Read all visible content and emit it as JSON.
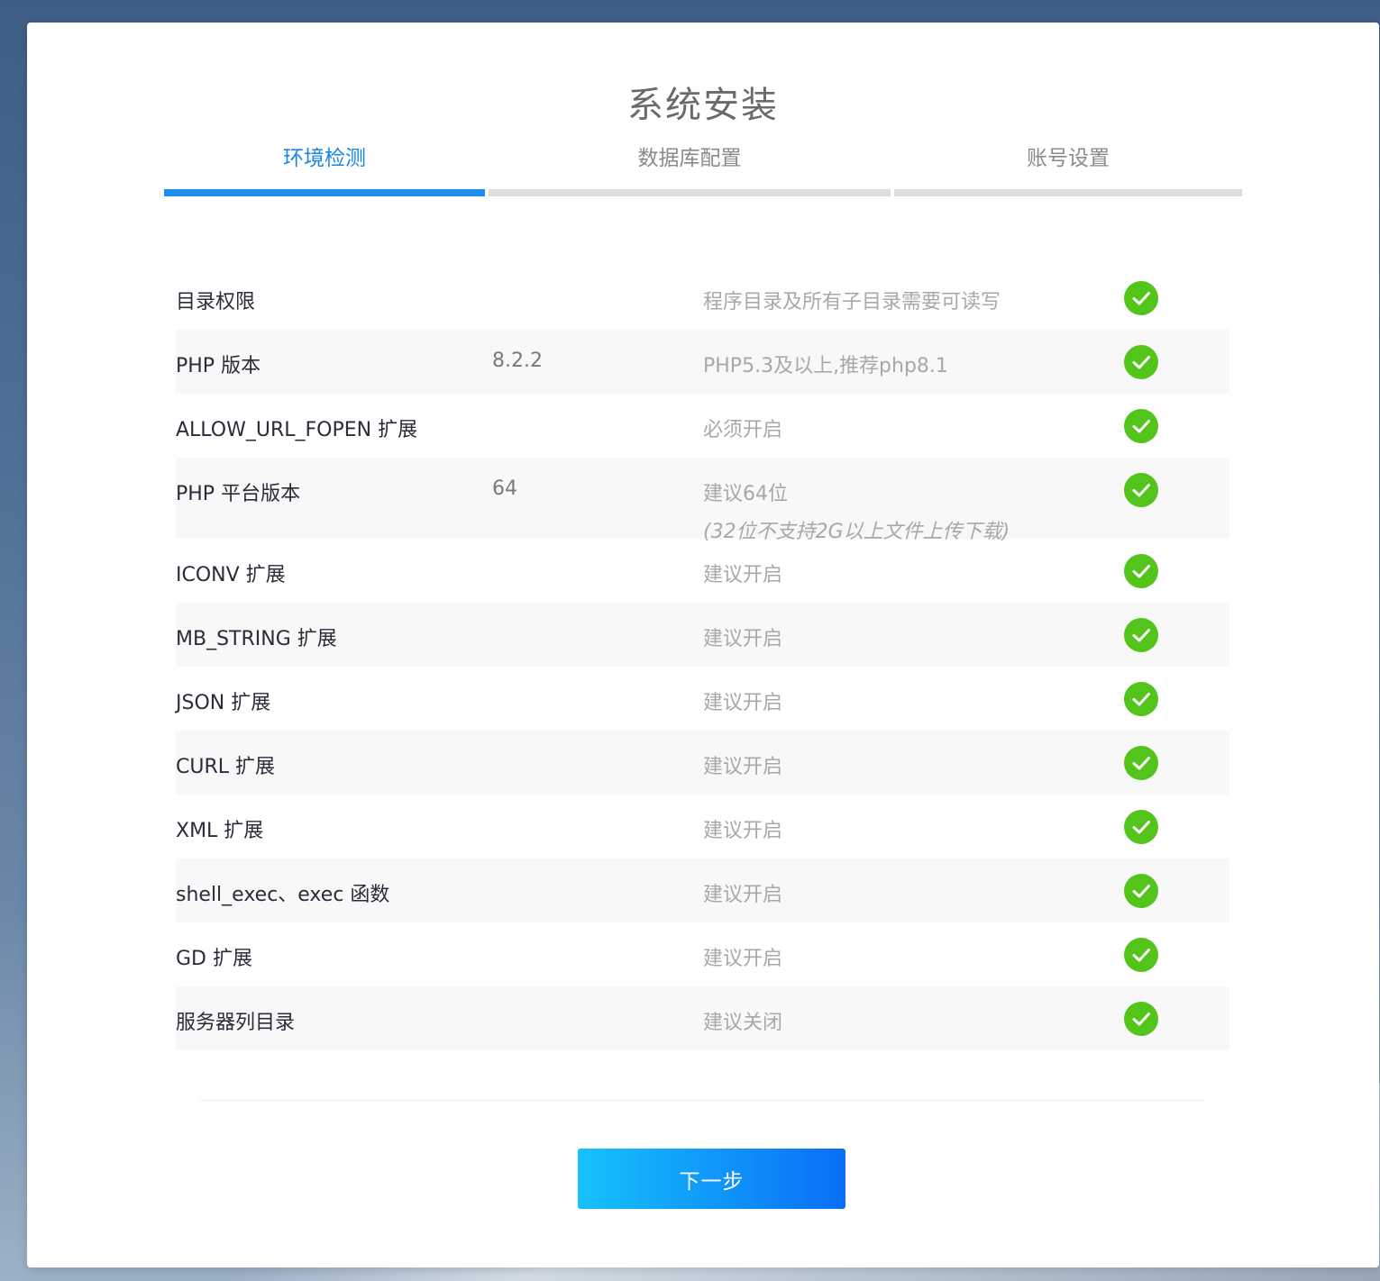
{
  "page": {
    "title": "系统安装"
  },
  "steps": [
    {
      "label": "环境检测",
      "active": true
    },
    {
      "label": "数据库配置",
      "active": false
    },
    {
      "label": "账号设置",
      "active": false
    }
  ],
  "checks": [
    {
      "name": "目录权限",
      "value": "",
      "requirement": "程序目录及所有子目录需要可读写",
      "note": "",
      "status": "ok"
    },
    {
      "name": "PHP 版本",
      "value": "8.2.2",
      "requirement": "PHP5.3及以上,推荐php8.1",
      "note": "",
      "status": "ok"
    },
    {
      "name": "ALLOW_URL_FOPEN 扩展",
      "value": "",
      "requirement": "必须开启",
      "note": "",
      "status": "ok"
    },
    {
      "name": "PHP 平台版本",
      "value": "64",
      "requirement": "建议64位",
      "note": "(32位不支持2G以上文件上传下载)",
      "status": "ok"
    },
    {
      "name": "ICONV 扩展",
      "value": "",
      "requirement": "建议开启",
      "note": "",
      "status": "ok"
    },
    {
      "name": "MB_STRING 扩展",
      "value": "",
      "requirement": "建议开启",
      "note": "",
      "status": "ok"
    },
    {
      "name": "JSON 扩展",
      "value": "",
      "requirement": "建议开启",
      "note": "",
      "status": "ok"
    },
    {
      "name": "CURL 扩展",
      "value": "",
      "requirement": "建议开启",
      "note": "",
      "status": "ok"
    },
    {
      "name": "XML 扩展",
      "value": "",
      "requirement": "建议开启",
      "note": "",
      "status": "ok"
    },
    {
      "name": "shell_exec、exec 函数",
      "value": "",
      "requirement": "建议开启",
      "note": "",
      "status": "ok"
    },
    {
      "name": "GD 扩展",
      "value": "",
      "requirement": "建议开启",
      "note": "",
      "status": "ok"
    },
    {
      "name": "服务器列目录",
      "value": "",
      "requirement": "建议关闭",
      "note": "",
      "status": "ok"
    }
  ],
  "actions": {
    "next_label": "下一步"
  },
  "colors": {
    "accent": "#1c8ef0",
    "ok": "#52c41a",
    "step_inactive": "#dedede"
  },
  "icons": {
    "status_ok": "check-circle-icon"
  }
}
